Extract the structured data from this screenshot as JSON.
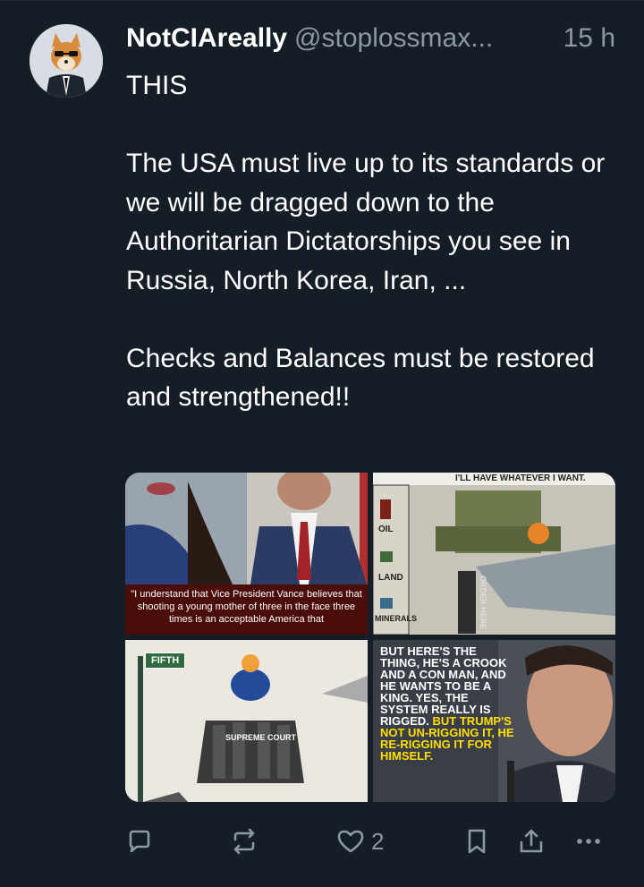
{
  "post": {
    "author_name": "NotCIAreally",
    "handle": "@stoplossmax...",
    "time": "15 h",
    "text": "THIS\n\nThe USA must live up to its standards or we will be dragged down to the Authoritarian Dictatorships you see in Russia, North Korea, Iran, ...\n\nChecks and Balances must be restored and strengthened!!"
  },
  "media": {
    "image1_caption": "\"I understand that Vice President Vance believes that shooting a young mother of three in the face three times is an acceptable America that",
    "image2_labels": {
      "top": "I'LL HAVE WHATEVER I WANT.",
      "oil": "OIL",
      "land": "LAND",
      "minerals": "MINERALS",
      "order": "ORDER HERE"
    },
    "image3_labels": {
      "street_sign": "FIFTH",
      "court": "SUPREME COURT"
    },
    "image4_text": {
      "white": "BUT HERE'S THE THING, HE'S A CROOK AND A CON MAN, AND HE WANTS TO BE A KING. YES, THE SYSTEM REALLY IS RIGGED.",
      "yellow": "BUT TRUMP'S NOT UN-RIGGING IT, HE RE-RIGGING IT FOR HIMSELF."
    }
  },
  "actions": {
    "like_count": "2"
  },
  "colors": {
    "background": "#151d27",
    "muted": "#8b98a5",
    "text": "#ffffff"
  }
}
